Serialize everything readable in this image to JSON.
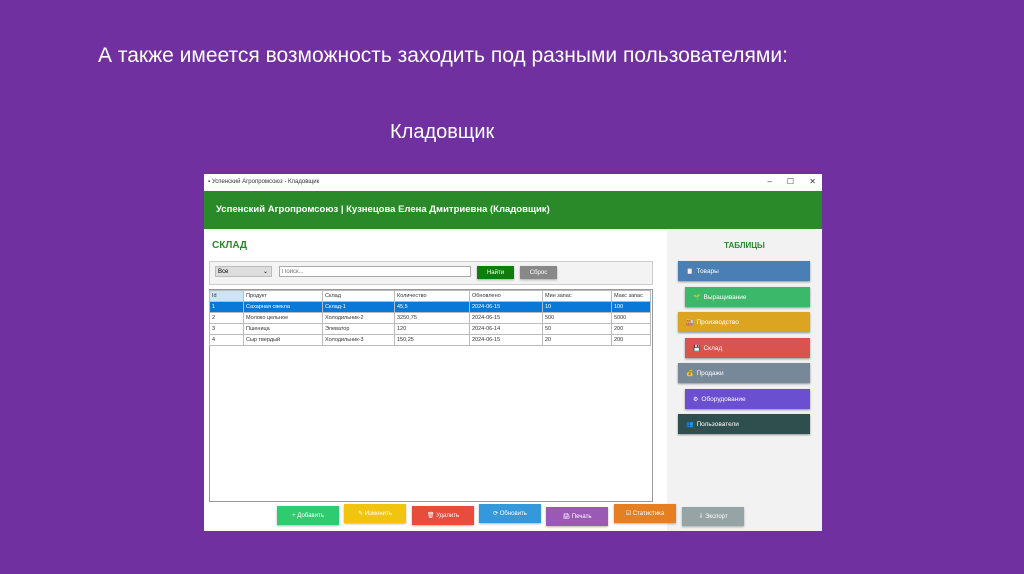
{
  "slide": {
    "title": "А также имеется возможность заходить под разными пользователями:",
    "subtitle": "Кладовщик"
  },
  "window": {
    "title": "Успенский Агропромсоюз - Кладовщик",
    "minimize": "–",
    "maximize": "☐",
    "close": "✕"
  },
  "header": "Успенский Агропромсоюз | Кузнецова Елена Дмитриевна (Кладовщик)",
  "section": "СКЛАД",
  "filter": {
    "select": "Все",
    "placeholder": "Поиск...",
    "find": "Найти",
    "reset": "Сброс"
  },
  "table": {
    "columns": [
      "Id",
      "Продукт",
      "Склад",
      "Количество",
      "Обновлено",
      "Мин запас",
      "Макс запас"
    ],
    "rows": [
      [
        "1",
        "Сахарная свекла",
        "Склад-1",
        "45,5",
        "2024-06-15",
        "10",
        "100"
      ],
      [
        "2",
        "Молоко цельное",
        "Холодильник-2",
        "3250,75",
        "2024-06-15",
        "500",
        "5000"
      ],
      [
        "3",
        "Пшеница",
        "Элеватор",
        "120",
        "2024-06-14",
        "50",
        "200"
      ],
      [
        "4",
        "Сыр твердый",
        "Холодильник-3",
        "150,25",
        "2024-06-15",
        "20",
        "200"
      ]
    ]
  },
  "sidebar": {
    "title": "ТАБЛИЦЫ",
    "items": [
      {
        "label": "Товары",
        "icon": "📋",
        "color": "#4a7fb5"
      },
      {
        "label": "Выращивание",
        "icon": "🌱",
        "color": "#3cb86a"
      },
      {
        "label": "Производство",
        "icon": "🏭",
        "color": "#dba521"
      },
      {
        "label": "Склад",
        "icon": "💾",
        "color": "#d9534f"
      },
      {
        "label": "Продажи",
        "icon": "💰",
        "color": "#778899"
      },
      {
        "label": "Оборудование",
        "icon": "⚙",
        "color": "#6a4fd0"
      },
      {
        "label": "Пользователи",
        "icon": "👥",
        "color": "#2f4f4f"
      }
    ]
  },
  "actions": [
    {
      "label": "+ Добавить",
      "color": "#2ecc71"
    },
    {
      "label": "✎ Изменить",
      "color": "#f1c40f"
    },
    {
      "label": "🗑 Удалить",
      "color": "#e74c3c"
    },
    {
      "label": "⟳ Обновить",
      "color": "#3498db"
    },
    {
      "label": "🖨 Печать",
      "color": "#9b59b6"
    },
    {
      "label": "☑ Статистика",
      "color": "#e67e22"
    },
    {
      "label": "⇩ Экспорт",
      "color": "#95a5a6"
    }
  ]
}
